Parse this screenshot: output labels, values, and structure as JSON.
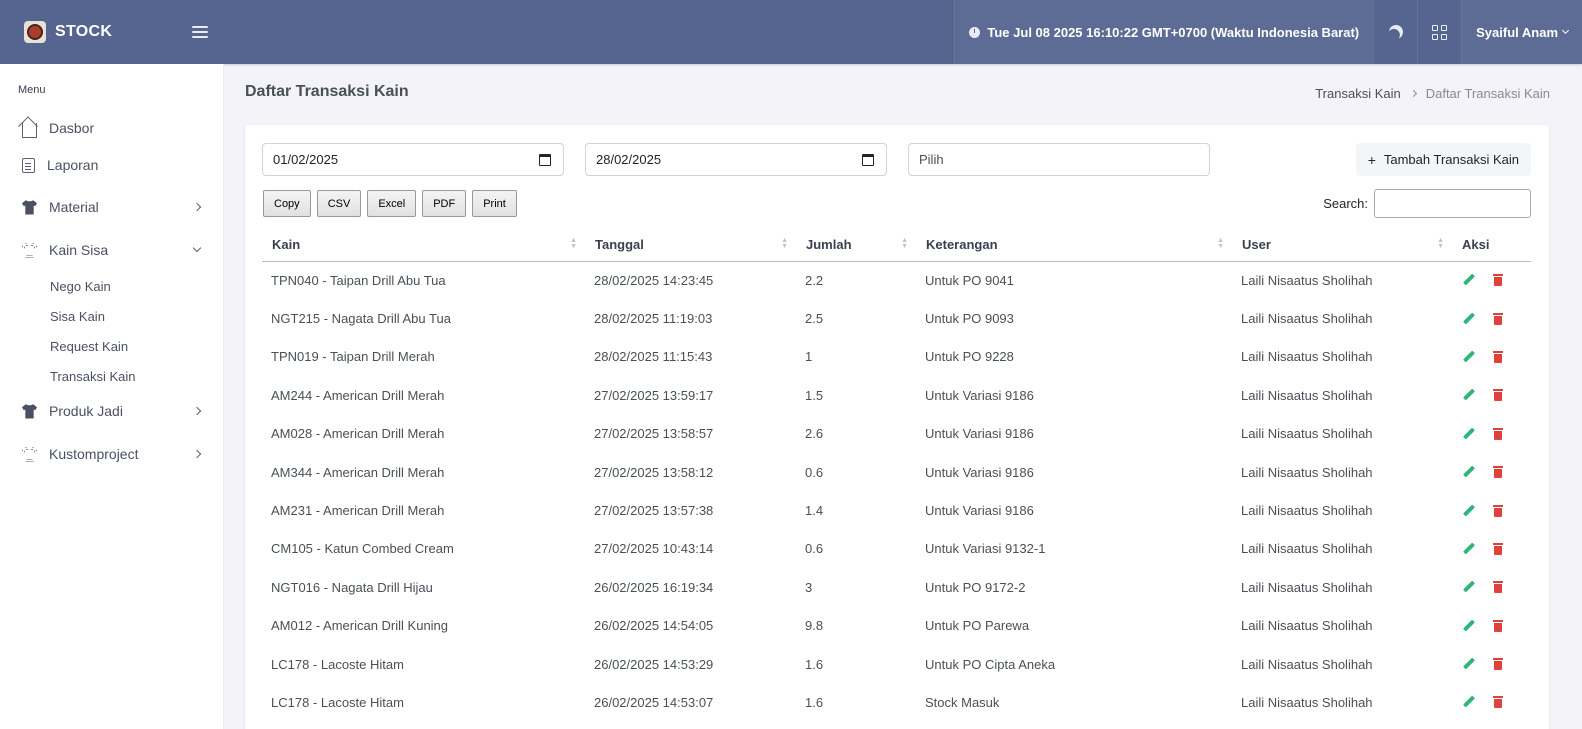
{
  "app": {
    "brand": "STOCK"
  },
  "header": {
    "clock": "Tue Jul 08 2025 16:10:22 GMT+0700 (Waktu Indonesia Barat)",
    "user": "Syaiful Anam"
  },
  "sidebar": {
    "menu_title": "Menu",
    "items": [
      {
        "label": "Dasbor",
        "icon": "home-icon"
      },
      {
        "label": "Laporan",
        "icon": "document-icon"
      },
      {
        "label": "Material",
        "icon": "shirt-icon"
      },
      {
        "label": "Kain Sisa",
        "icon": "shirt-outline-icon"
      },
      {
        "label": "Produk Jadi",
        "icon": "shirt-icon"
      },
      {
        "label": "Kustomproject",
        "icon": "shirt-outline-icon"
      }
    ],
    "sub_items": [
      "Nego Kain",
      "Sisa Kain",
      "Request Kain",
      "Transaksi Kain"
    ]
  },
  "page": {
    "title": "Daftar Transaksi Kain",
    "breadcrumb": [
      "Transaksi Kain",
      "Daftar Transaksi Kain"
    ]
  },
  "filters": {
    "date_from": "01/02/2025",
    "date_to": "28/02/2025",
    "select_placeholder": "Pilih",
    "add_button": "Tambah Transaksi Kain"
  },
  "export_buttons": [
    "Copy",
    "CSV",
    "Excel",
    "PDF",
    "Print"
  ],
  "search_label": "Search:",
  "table": {
    "columns": [
      "Kain",
      "Tanggal",
      "Jumlah",
      "Keterangan",
      "User",
      "Aksi"
    ],
    "rows": [
      [
        "TPN040 - Taipan Drill Abu Tua",
        "28/02/2025 14:23:45",
        "2.2",
        "Untuk PO 9041",
        "Laili Nisaatus Sholihah"
      ],
      [
        "NGT215 - Nagata Drill Abu Tua",
        "28/02/2025 11:19:03",
        "2.5",
        "Untuk PO 9093",
        "Laili Nisaatus Sholihah"
      ],
      [
        "TPN019 - Taipan Drill Merah",
        "28/02/2025 11:15:43",
        "1",
        "Untuk PO 9228",
        "Laili Nisaatus Sholihah"
      ],
      [
        "AM244 - American Drill Merah",
        "27/02/2025 13:59:17",
        "1.5",
        "Untuk Variasi 9186",
        "Laili Nisaatus Sholihah"
      ],
      [
        "AM028 - American Drill Merah",
        "27/02/2025 13:58:57",
        "2.6",
        "Untuk Variasi 9186",
        "Laili Nisaatus Sholihah"
      ],
      [
        "AM344 - American Drill Merah",
        "27/02/2025 13:58:12",
        "0.6",
        "Untuk Variasi 9186",
        "Laili Nisaatus Sholihah"
      ],
      [
        "AM231 - American Drill Merah",
        "27/02/2025 13:57:38",
        "1.4",
        "Untuk Variasi 9186",
        "Laili Nisaatus Sholihah"
      ],
      [
        "CM105 - Katun Combed Cream",
        "27/02/2025 10:43:14",
        "0.6",
        "Untuk Variasi 9132-1",
        "Laili Nisaatus Sholihah"
      ],
      [
        "NGT016 - Nagata Drill Hijau",
        "26/02/2025 16:19:34",
        "3",
        "Untuk PO 9172-2",
        "Laili Nisaatus Sholihah"
      ],
      [
        "AM012 - American Drill Kuning",
        "26/02/2025 14:54:05",
        "9.8",
        "Untuk PO Parewa",
        "Laili Nisaatus Sholihah"
      ],
      [
        "LC178 - Lacoste Hitam",
        "26/02/2025 14:53:29",
        "1.6",
        "Untuk PO Cipta Aneka",
        "Laili Nisaatus Sholihah"
      ],
      [
        "LC178 - Lacoste Hitam",
        "26/02/2025 14:53:07",
        "1.6",
        "Stock Masuk",
        "Laili Nisaatus Sholihah"
      ]
    ]
  },
  "colors": {
    "topbar": "#556590",
    "edit": "#2fb57a",
    "delete": "#e1413c"
  }
}
